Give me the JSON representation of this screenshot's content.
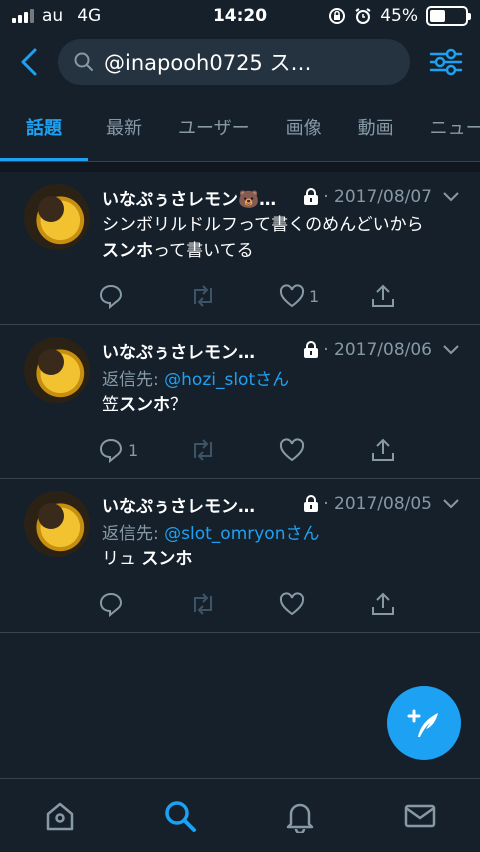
{
  "status": {
    "carrier": "au",
    "network": "4G",
    "time": "14:20",
    "battery": "45%",
    "battery_level": 0.45
  },
  "search": {
    "query": "@inapooh0725 ス…"
  },
  "tabs": [
    {
      "label": "話題",
      "active": true
    },
    {
      "label": "最新"
    },
    {
      "label": "ユーザー"
    },
    {
      "label": "画像"
    },
    {
      "label": "動画"
    },
    {
      "label": "ニュー"
    }
  ],
  "tweets": [
    {
      "name": "いなぷぅさレモン🐻 …",
      "date": "· 2017/08/07",
      "text_plain1": "シンボリルドルフって書くのめんどいから",
      "text_bold": "スンホ",
      "text_plain2": "って書いてる",
      "reply_count": "",
      "like_count": "1"
    },
    {
      "name": "いなぷぅさレモン…",
      "date": "· 2017/08/06",
      "reply_label": "返信先: ",
      "reply_handle": "@hozi_slotさん",
      "text_plain1": "笠",
      "text_bold": "スンホ",
      "text_plain2": "？",
      "reply_count": "1",
      "like_count": ""
    },
    {
      "name": "いなぷぅさレモン…",
      "date": "· 2017/08/05",
      "reply_label": "返信先: ",
      "reply_handle": "@slot_omryonさん",
      "text_plain1": "リュ ",
      "text_bold": "スンホ",
      "text_plain2": "",
      "reply_count": "",
      "like_count": ""
    }
  ],
  "colors": {
    "accent": "#1da1f2",
    "background": "#15202b",
    "muted": "#8899a6"
  },
  "icons": {
    "back": "back-arrow-icon",
    "search": "search-icon",
    "filter": "filter-sliders-icon",
    "fab": "compose-quill-icon",
    "nav": [
      "home-icon",
      "search-icon",
      "bell-icon",
      "mail-icon"
    ]
  }
}
